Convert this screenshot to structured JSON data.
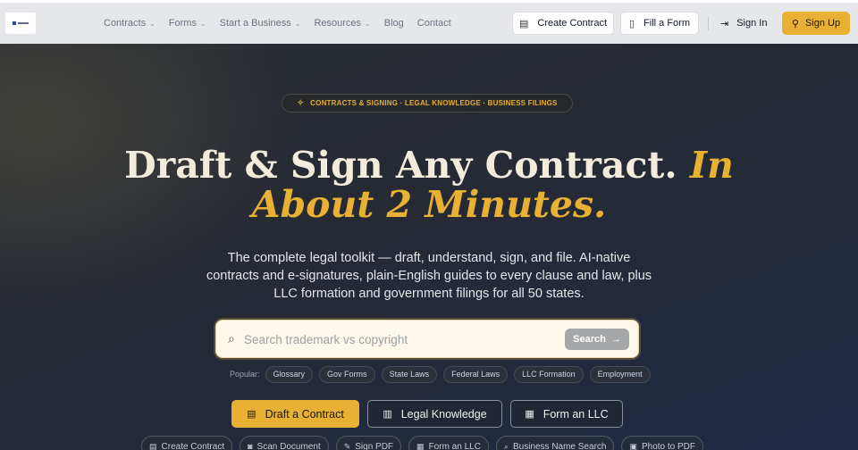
{
  "nav": {
    "links": [
      {
        "label": "Contracts",
        "dropdown": true
      },
      {
        "label": "Forms",
        "dropdown": true
      },
      {
        "label": "Start a Business",
        "dropdown": true
      },
      {
        "label": "Resources",
        "dropdown": true
      },
      {
        "label": "Blog",
        "dropdown": false
      },
      {
        "label": "Contact",
        "dropdown": false
      }
    ],
    "create_contract": "Create Contract",
    "fill_form": "Fill a Form",
    "sign_in": "Sign In",
    "sign_up": "Sign Up",
    "chevron": "⌄"
  },
  "hero": {
    "tagline": "CONTRACTS & SIGNING · LEGAL KNOWLEDGE · BUSINESS FILINGS",
    "headline_part1": "Draft & Sign Any Contract. ",
    "headline_accent1": "In",
    "headline_line2": "About 2 Minutes.",
    "subtitle": "The complete legal toolkit — draft, understand, sign, and file. AI-native contracts and e-signatures, plain-English guides to every clause and law, plus LLC formation and government filings for all 50 states."
  },
  "search": {
    "placeholder": "Search trademark vs copyright",
    "button_label": "Search"
  },
  "popular": {
    "label": "Popular:",
    "chips": [
      "Glossary",
      "Gov Forms",
      "State Laws",
      "Federal Laws",
      "LLC Formation",
      "Employment"
    ]
  },
  "cta": {
    "draft": "Draft a Contract",
    "knowledge": "Legal Knowledge",
    "llc": "Form an LLC"
  },
  "tools": [
    "Create Contract",
    "Scan Document",
    "Sign PDF",
    "Form an LLC",
    "Business Name Search",
    "Photo to PDF"
  ],
  "icons": {
    "create_contract": "document-icon",
    "fill_form": "form-icon",
    "sign_in": "sign-in-icon",
    "sign_up": "user-plus-icon",
    "tagline": "sparkle-icon",
    "search": "search-icon",
    "knowledge": "book-icon",
    "llc": "building-icon"
  },
  "colors": {
    "accent": "#e8b133",
    "navbar_bg": "#e6e7ea",
    "hero_bg": "#262a33",
    "headline": "#f3ecdd"
  }
}
